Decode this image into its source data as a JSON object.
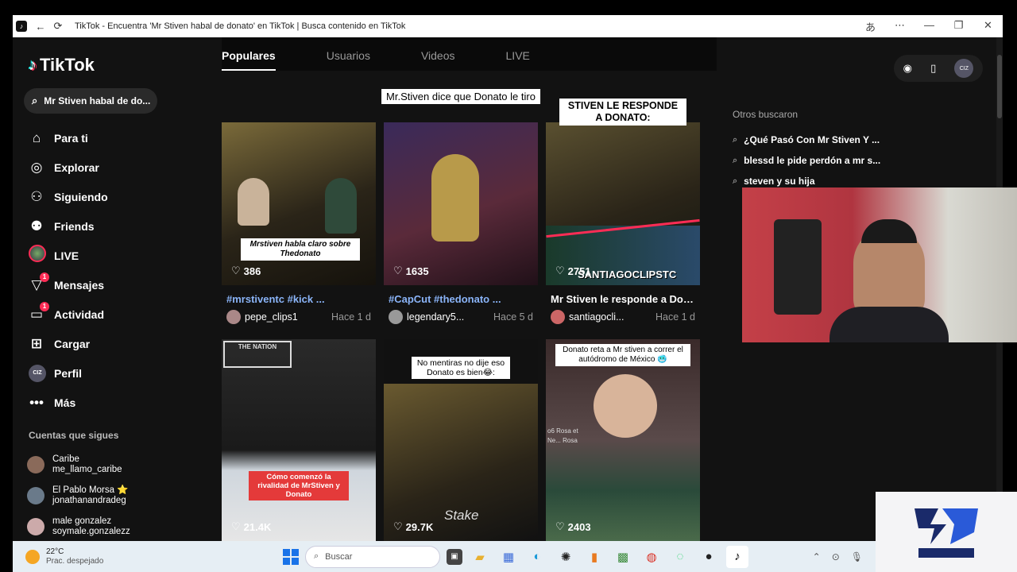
{
  "window": {
    "title": "TikTok - Encuentra 'Mr Stiven habal de donato' en TikTok | Busca contenido en TikTok"
  },
  "sidebar": {
    "logo": "TikTok",
    "search_value": "Mr Stiven habal de do...",
    "nav": [
      {
        "label": "Para ti",
        "icon": "home-icon"
      },
      {
        "label": "Explorar",
        "icon": "compass-icon"
      },
      {
        "label": "Siguiendo",
        "icon": "following-icon"
      },
      {
        "label": "Friends",
        "icon": "friends-icon"
      },
      {
        "label": "LIVE",
        "icon": "live-avatar"
      },
      {
        "label": "Mensajes",
        "icon": "messages-icon",
        "badge": "1"
      },
      {
        "label": "Actividad",
        "icon": "activity-icon",
        "badge": "1"
      },
      {
        "label": "Cargar",
        "icon": "upload-icon"
      },
      {
        "label": "Perfil",
        "icon": "profile-avatar"
      },
      {
        "label": "Más",
        "icon": "more-icon"
      }
    ],
    "following_title": "Cuentas que sigues",
    "following": [
      {
        "name": "Caribe",
        "handle": "me_llamo_caribe"
      },
      {
        "name": "El Pablo Morsa ⭐",
        "handle": "jonathanandradeg"
      },
      {
        "name": "male gonzalez",
        "handle": "soymale.gonzalezz"
      }
    ]
  },
  "tabs": [
    "Populares",
    "Usuarios",
    "Videos",
    "LIVE"
  ],
  "videos": [
    {
      "caption_top": "",
      "overlay": "Mrstiven habla claro sobre Thedonato",
      "likes": "386",
      "title_tags": "#mrstiventc #kick ...",
      "user": "pepe_clips1",
      "time": "Hace 1 d",
      "tone": "#5a4a30"
    },
    {
      "caption_top": "Mr.Stiven dice que Donato le tiro",
      "overlay": "",
      "likes": "1635",
      "title_tags": "#CapCut #thedonato ...",
      "user": "legendary5...",
      "time": "Hace 5 d",
      "tone": "#4a2a4a"
    },
    {
      "caption_top": "STIVEN LE RESPONDE A DONATO:",
      "overlay": "SANTIAGOCLIPSTC",
      "likes": "2751",
      "title_tags": "Mr Stiven le responde a Don...",
      "user": "santiagocli...",
      "time": "Hace 1 d",
      "tone": "#3a3a2a"
    },
    {
      "caption_top": "",
      "overlay": "Cómo comenzó la rivalidad de MrStiven y Donato",
      "likes": "21.4K",
      "title_tags": "",
      "user": "",
      "time": "",
      "tone": "#3a3a3a",
      "badge_text": "THE NATION"
    },
    {
      "caption_top": "No mentiras no dije eso Donato es bien😂:",
      "overlay": "Stake",
      "likes": "29.7K",
      "title_tags": "",
      "user": "",
      "time": "",
      "tone": "#4a3a20"
    },
    {
      "caption_top": "Donato reta a Mr stiven a correr el autódromo de México 🥶",
      "overlay": "",
      "likes": "2403",
      "title_tags": "",
      "user": "",
      "time": "",
      "tone": "#5a4040",
      "side_text": "o6 Rosa et Ne... Rosa"
    }
  ],
  "right": {
    "others_title": "Otros buscaron",
    "others": [
      "¿Qué Pasó Con Mr Stiven Y ...",
      "blessd le pide perdón a mr s...",
      "steven y su hija"
    ]
  },
  "taskbar": {
    "temp": "22°C",
    "weather": "Prac. despejado",
    "search_placeholder": "Buscar"
  },
  "colors": {
    "accent": "#fe2c55",
    "cyan": "#25f4ee",
    "bg": "#121212"
  }
}
